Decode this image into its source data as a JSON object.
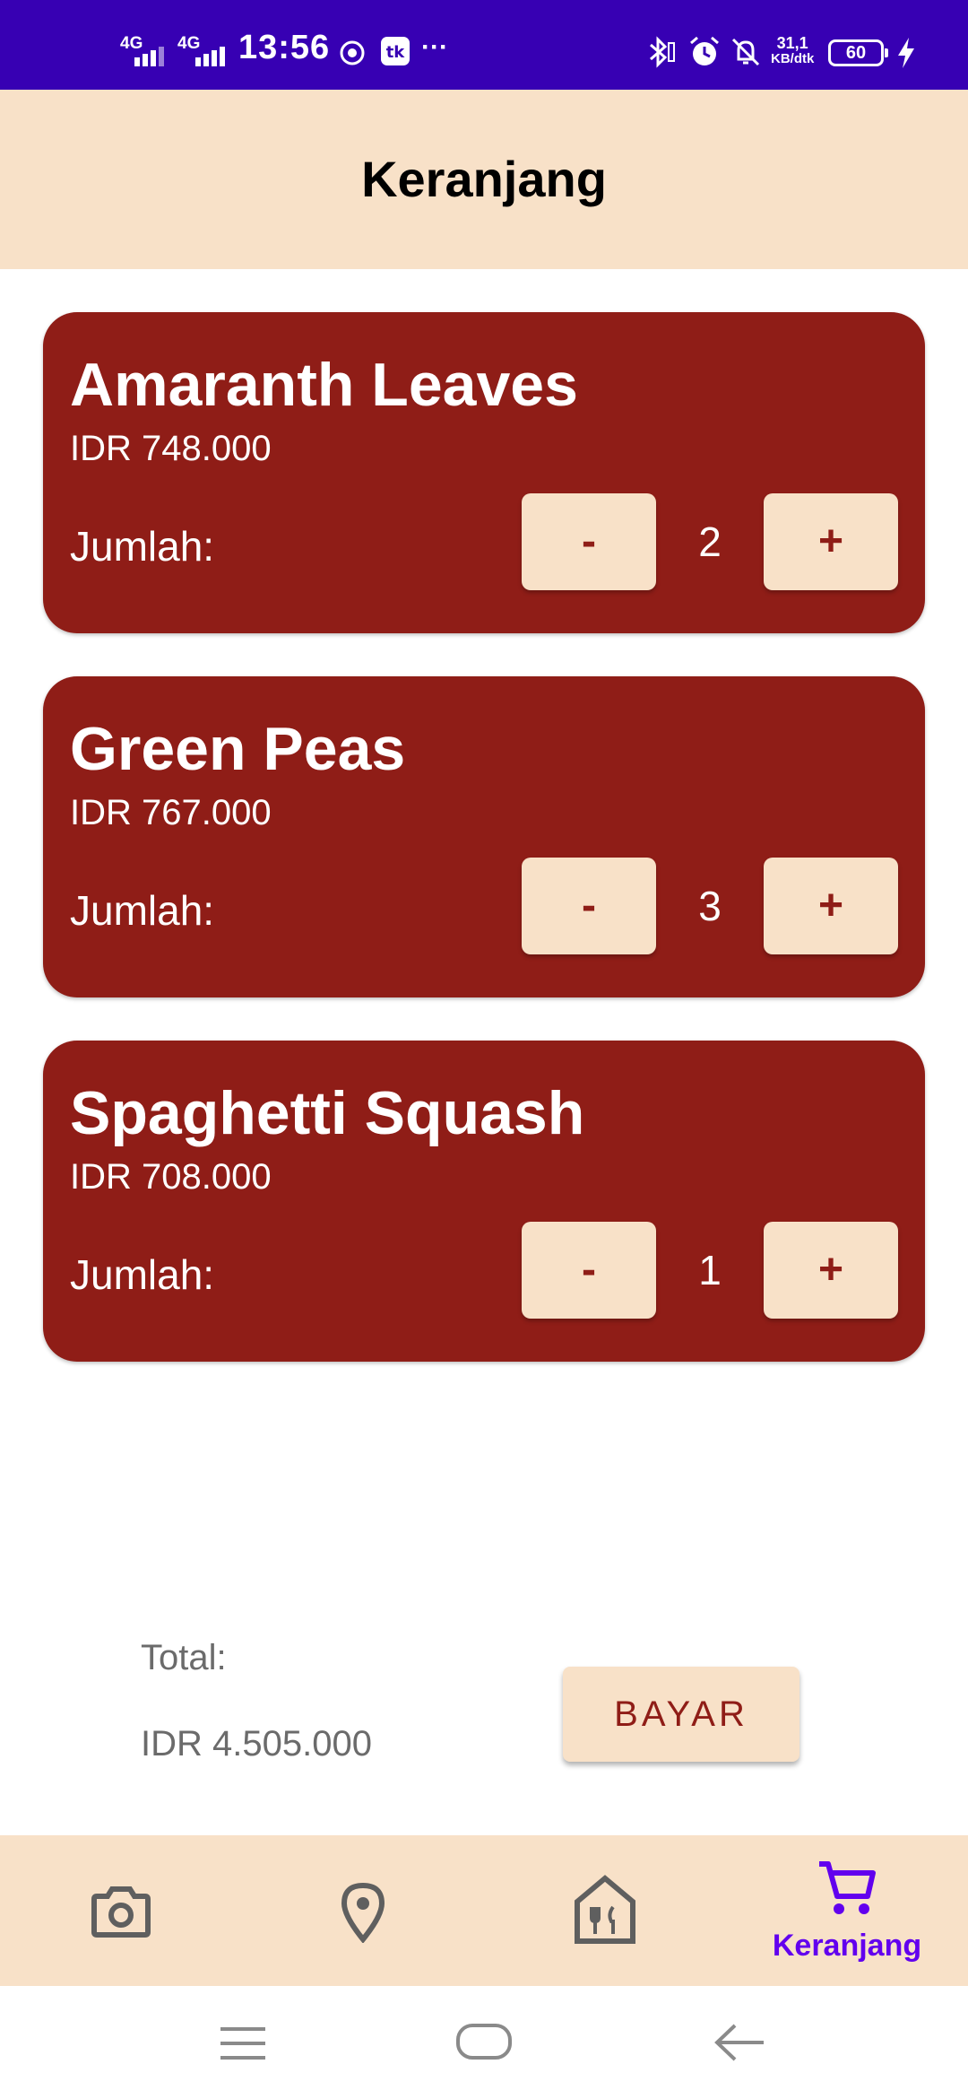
{
  "status_bar": {
    "time": "13:56",
    "signal_1": "4G",
    "signal_2": "4G",
    "net_speed_value": "31,1",
    "net_speed_unit": "KB/dtk",
    "battery": "60",
    "more": "···"
  },
  "app_bar": {
    "title": "Keranjang"
  },
  "cart": {
    "items": [
      {
        "name": "Amaranth Leaves",
        "price": "IDR 748.000",
        "qty_label": "Jumlah:",
        "qty": "2",
        "minus": "-",
        "plus": "+"
      },
      {
        "name": "Green Peas",
        "price": "IDR 767.000",
        "qty_label": "Jumlah:",
        "qty": "3",
        "minus": "-",
        "plus": "+"
      },
      {
        "name": "Spaghetti Squash",
        "price": "IDR 708.000",
        "qty_label": "Jumlah:",
        "qty": "1",
        "minus": "-",
        "plus": "+"
      }
    ]
  },
  "summary": {
    "total_label": "Total:",
    "total_value": "IDR 4.505.000",
    "pay_label": "BAYAR"
  },
  "bottom_nav": {
    "items": [
      {
        "icon": "camera-icon"
      },
      {
        "icon": "location-pin-icon"
      },
      {
        "icon": "restaurant-icon"
      },
      {
        "icon": "cart-icon",
        "label": "Keranjang",
        "active": true
      }
    ]
  },
  "colors": {
    "status_bar": "#3700b3",
    "accent_bg": "#f8e1c8",
    "card": "#8f1d17",
    "active_nav": "#6200ee",
    "inactive_nav": "#5f5f5f"
  }
}
